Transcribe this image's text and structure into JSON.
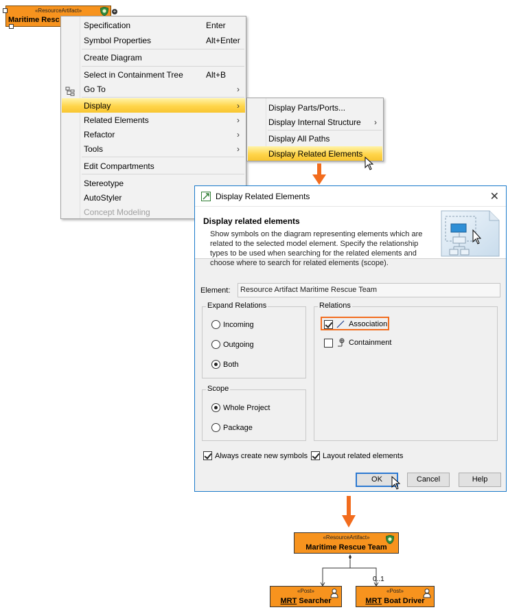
{
  "top_element": {
    "stereotype": "«ResourceArtifact»",
    "name": "Maritime Resc"
  },
  "context_menu": {
    "items": [
      {
        "label": "Specification",
        "shortcut": "Enter"
      },
      {
        "label": "Symbol Properties",
        "shortcut": "Alt+Enter"
      },
      {
        "label": "Create Diagram"
      },
      {
        "label": "Select in Containment Tree",
        "shortcut": "Alt+B"
      },
      {
        "label": "Go To",
        "submenu": true
      },
      {
        "label": "Display",
        "submenu": true,
        "highlighted": true
      },
      {
        "label": "Related Elements",
        "submenu": true
      },
      {
        "label": "Refactor",
        "submenu": true
      },
      {
        "label": "Tools",
        "submenu": true
      },
      {
        "label": "Edit Compartments"
      },
      {
        "label": "Stereotype"
      },
      {
        "label": "AutoStyler"
      },
      {
        "label": "Concept Modeling",
        "disabled": true
      }
    ]
  },
  "display_submenu": {
    "items": [
      {
        "label": "Display Parts/Ports..."
      },
      {
        "label": "Display Internal Structure",
        "submenu": true
      },
      {
        "label": "Display All Paths"
      },
      {
        "label": "Display Related Elements",
        "highlighted": true
      }
    ]
  },
  "dialog": {
    "title": "Display Related Elements",
    "heading": "Display related elements",
    "description": "Show symbols on the diagram representing elements which are related to the selected model element. Specify the relationship types to be used when searching for the related elements and choose where to search for related elements (scope).",
    "element_label": "Element:",
    "element_value": "Resource Artifact Maritime Rescue Team",
    "expand_relations": {
      "title": "Expand Relations",
      "options": [
        "Incoming",
        "Outgoing",
        "Both"
      ],
      "selected": "Both"
    },
    "scope": {
      "title": "Scope",
      "options": [
        "Whole Project",
        "Package"
      ],
      "selected": "Whole Project"
    },
    "relations": {
      "title": "Relations",
      "items": [
        {
          "label": "Association",
          "checked": true
        },
        {
          "label": "Containment",
          "checked": false
        }
      ]
    },
    "always_create_new_symbols": {
      "label": "Always create new symbols",
      "checked": true
    },
    "layout_related_elements": {
      "label": "Layout related elements",
      "checked": true
    },
    "buttons": {
      "ok": "OK",
      "cancel": "Cancel",
      "help": "Help"
    }
  },
  "result_diagram": {
    "parent": {
      "stereotype": "«ResourceArtifact»",
      "name": "Maritime Rescue Team"
    },
    "children": [
      {
        "stereotype": "«Post»",
        "name_prefix": "MRT",
        "name_suffix": " Searcher"
      },
      {
        "stereotype": "«Post»",
        "name_prefix": "MRT",
        "name_suffix": " Boat Driver"
      }
    ],
    "multiplicity": "0..1"
  },
  "colors": {
    "element_fill": "#f7931e",
    "menu_highlight": "#ffd54a",
    "arrow": "#f26c1d",
    "dialog_border": "#1979ca",
    "ok_border": "#2b78d1"
  }
}
